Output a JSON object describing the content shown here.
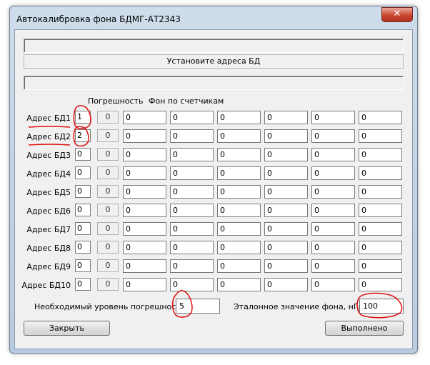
{
  "window": {
    "title": "Автокалибровка фона БДМГ-АТ2343",
    "close_symbol": "✕"
  },
  "status_label": "Установите адреса БД",
  "headers": {
    "error": "Погрешность",
    "background": "Фон по счетчикам"
  },
  "rows": [
    {
      "label": "Адрес БД1",
      "address": "1",
      "error": "0",
      "counters": [
        "0",
        "0",
        "0",
        "0",
        "0",
        "0"
      ]
    },
    {
      "label": "Адрес БД2",
      "address": "2",
      "error": "0",
      "counters": [
        "0",
        "0",
        "0",
        "0",
        "0",
        "0"
      ]
    },
    {
      "label": "Адрес БД3",
      "address": "0",
      "error": "0",
      "counters": [
        "0",
        "0",
        "0",
        "0",
        "0",
        "0"
      ]
    },
    {
      "label": "Адрес БД4",
      "address": "0",
      "error": "0",
      "counters": [
        "0",
        "0",
        "0",
        "0",
        "0",
        "0"
      ]
    },
    {
      "label": "Адрес БД5",
      "address": "0",
      "error": "0",
      "counters": [
        "0",
        "0",
        "0",
        "0",
        "0",
        "0"
      ]
    },
    {
      "label": "Адрес БД6",
      "address": "0",
      "error": "0",
      "counters": [
        "0",
        "0",
        "0",
        "0",
        "0",
        "0"
      ]
    },
    {
      "label": "Адрес БД7",
      "address": "0",
      "error": "0",
      "counters": [
        "0",
        "0",
        "0",
        "0",
        "0",
        "0"
      ]
    },
    {
      "label": "Адрес БД8",
      "address": "0",
      "error": "0",
      "counters": [
        "0",
        "0",
        "0",
        "0",
        "0",
        "0"
      ]
    },
    {
      "label": "Адрес БД9",
      "address": "0",
      "error": "0",
      "counters": [
        "0",
        "0",
        "0",
        "0",
        "0",
        "0"
      ]
    },
    {
      "label": "Адрес БД10",
      "address": "0",
      "error": "0",
      "counters": [
        "0",
        "0",
        "0",
        "0",
        "0",
        "0"
      ]
    }
  ],
  "error_level": {
    "label": "Необходимый уровень погрешностей",
    "value": "5"
  },
  "reference": {
    "label": "Эталонное значение фона, нГр/ч",
    "value": "100"
  },
  "buttons": {
    "close": "Закрыть",
    "done": "Выполнено"
  },
  "colors": {
    "annotation": "#e01010"
  }
}
